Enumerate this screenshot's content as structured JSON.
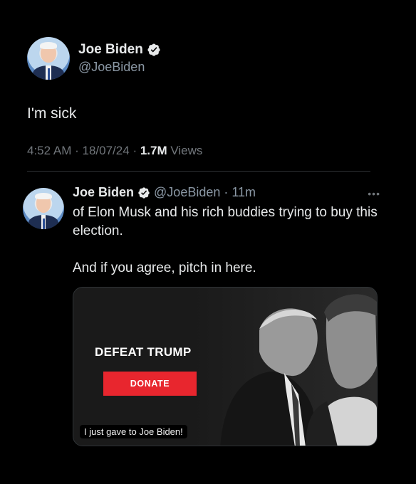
{
  "main_tweet": {
    "display_name": "Joe Biden",
    "handle": "@JoeBiden",
    "text": "I'm sick",
    "time": "4:52 AM",
    "date": "18/07/24",
    "views_count": "1.7M",
    "views_label": "Views",
    "separator": "·"
  },
  "quoted_tweet": {
    "display_name": "Joe Biden",
    "handle": "@JoeBiden",
    "age": "11m",
    "separator": "·",
    "text_line1": "of Elon Musk and his rich buddies trying to buy this election.",
    "text_line2": "And if you agree, pitch in here.",
    "more_icon": "more-horizontal-icon"
  },
  "media_card": {
    "headline": "DEFEAT TRUMP",
    "button_label": "DONATE",
    "caption": "I just gave to Joe Biden!",
    "button_color": "#e8262e"
  },
  "colors": {
    "background": "#000000",
    "text": "#e7e9ea",
    "muted": "#71767b",
    "verified": "#1d9bf0"
  }
}
